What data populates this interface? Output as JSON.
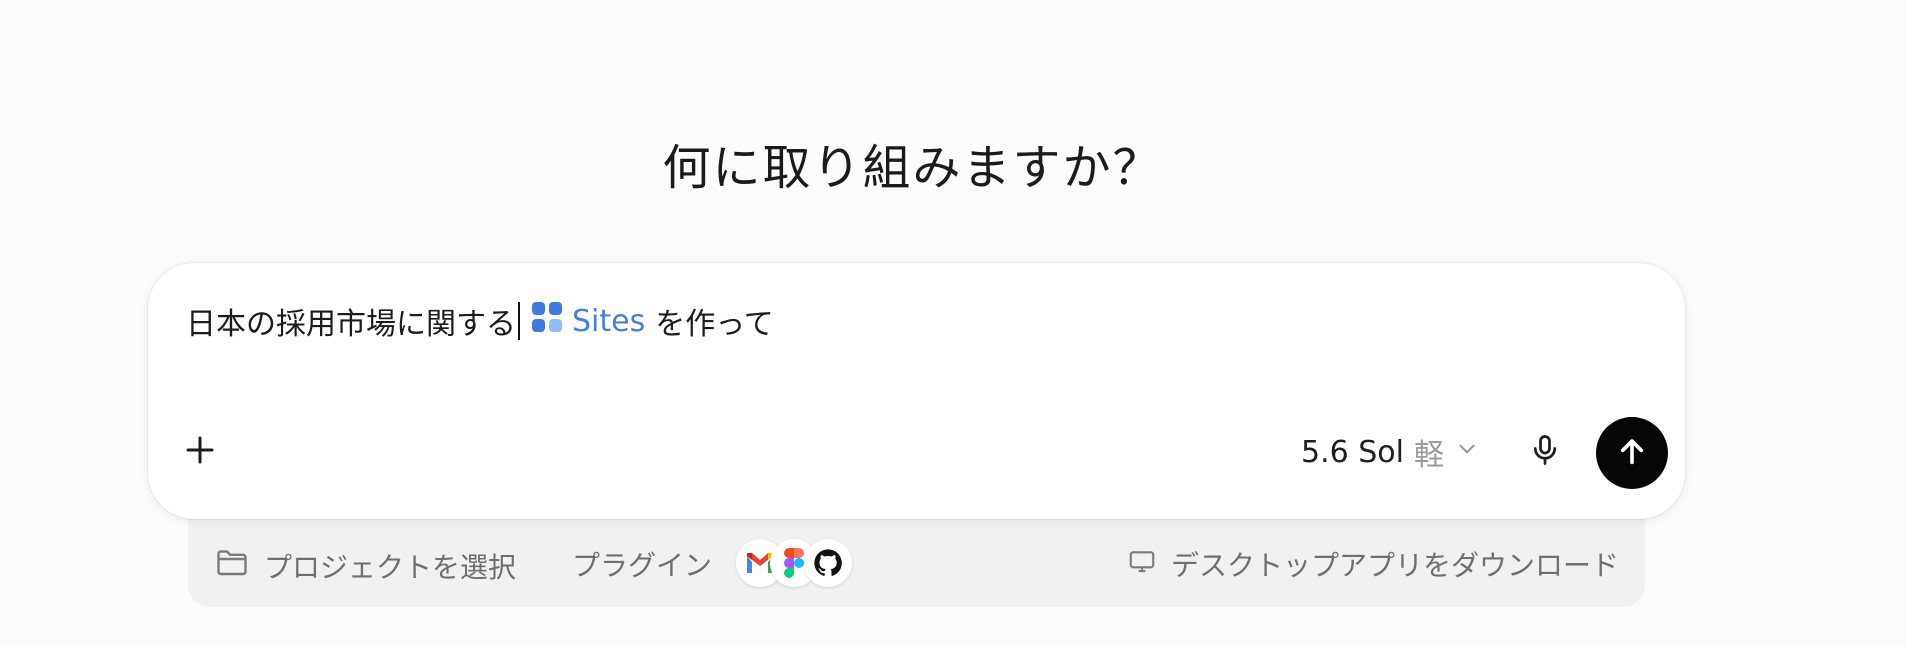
{
  "heading": "何に取り組みますか？",
  "composer": {
    "prompt_before": "日本の採用市場に関する",
    "chip_label": "Sites",
    "prompt_after": "を作って",
    "model_name": "5.6 Sol",
    "model_mode": "軽",
    "chip_icon": "sites-grid-icon",
    "accent_color": "#4a7fd6",
    "send_color": "#060606"
  },
  "tray": {
    "project_label": "プロジェクトを選択",
    "plugins_label": "プラグイン",
    "plugin_icons": [
      "gmail-icon",
      "figma-icon",
      "github-icon"
    ],
    "download_label": "デスクトップアプリをダウンロード"
  }
}
